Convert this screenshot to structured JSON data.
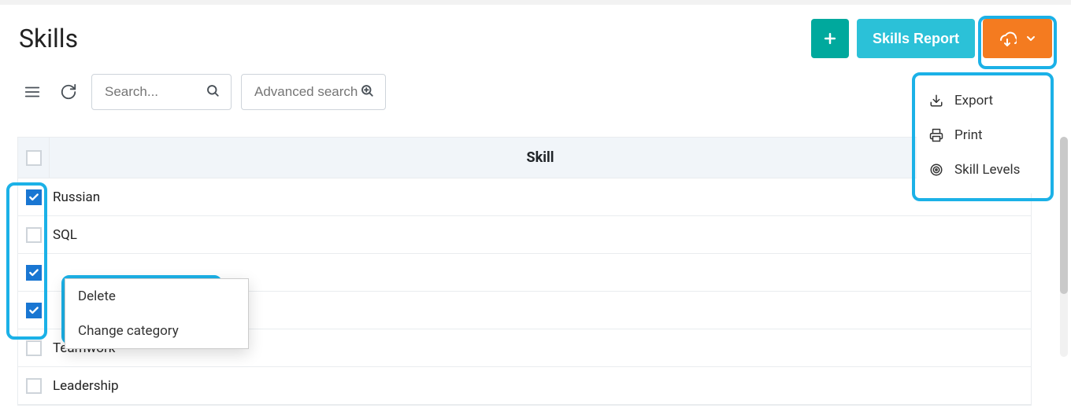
{
  "header": {
    "title": "Skills",
    "report_button": "Skills Report"
  },
  "toolbar": {
    "search_placeholder": "Search...",
    "advanced_search_placeholder": "Advanced search"
  },
  "table": {
    "header": "Skill",
    "rows": [
      {
        "label": "Russian",
        "checked": true
      },
      {
        "label": "SQL",
        "checked": false
      },
      {
        "label": "",
        "checked": true
      },
      {
        "label": "",
        "checked": true
      },
      {
        "label": "Teamwork",
        "checked": false
      },
      {
        "label": "Leadership",
        "checked": false
      }
    ]
  },
  "more_menu": {
    "items": [
      {
        "label": "Export",
        "icon": "download"
      },
      {
        "label": "Print",
        "icon": "print"
      },
      {
        "label": "Skill Levels",
        "icon": "target"
      }
    ]
  },
  "context_menu": {
    "items": [
      {
        "label": "Delete"
      },
      {
        "label": "Change category"
      }
    ]
  },
  "colors": {
    "highlight": "#1bb1e7",
    "teal": "#00a99d",
    "cyan": "#2bc1d8",
    "orange": "#f47b20",
    "checkbox_checked": "#1976d2"
  }
}
